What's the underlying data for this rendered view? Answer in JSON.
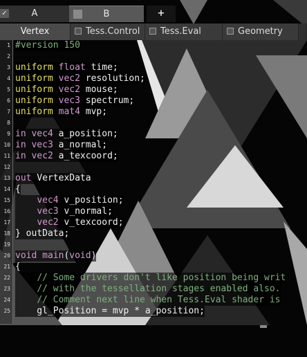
{
  "top_tabs": [
    {
      "label": "A",
      "checked": true
    },
    {
      "label": "B",
      "active": true
    },
    {
      "label": "+"
    }
  ],
  "shader_tabs": [
    {
      "label": "Vertex",
      "active": true
    },
    {
      "label": "Tess.Control"
    },
    {
      "label": "Tess.Eval"
    },
    {
      "label": "Geometry"
    }
  ],
  "editor": {
    "lines": [
      {
        "num": "1",
        "tokens": [
          {
            "t": "#version 150",
            "c": "dir"
          }
        ]
      },
      {
        "num": "2",
        "tokens": []
      },
      {
        "num": "3",
        "tokens": [
          {
            "t": "uniform",
            "c": "uni"
          },
          {
            "t": " "
          },
          {
            "t": "float",
            "c": "ty"
          },
          {
            "t": " time;"
          }
        ]
      },
      {
        "num": "4",
        "tokens": [
          {
            "t": "uniform",
            "c": "uni"
          },
          {
            "t": " "
          },
          {
            "t": "vec2",
            "c": "ty"
          },
          {
            "t": " resolution;"
          }
        ]
      },
      {
        "num": "5",
        "tokens": [
          {
            "t": "uniform",
            "c": "uni"
          },
          {
            "t": " "
          },
          {
            "t": "vec2",
            "c": "ty"
          },
          {
            "t": " mouse;"
          }
        ]
      },
      {
        "num": "6",
        "tokens": [
          {
            "t": "uniform",
            "c": "uni"
          },
          {
            "t": " "
          },
          {
            "t": "vec3",
            "c": "ty"
          },
          {
            "t": " spectrum;"
          }
        ]
      },
      {
        "num": "7",
        "tokens": [
          {
            "t": "uniform",
            "c": "uni"
          },
          {
            "t": " "
          },
          {
            "t": "mat4",
            "c": "ty"
          },
          {
            "t": " mvp;"
          }
        ]
      },
      {
        "num": "8",
        "tokens": []
      },
      {
        "num": "9",
        "tokens": [
          {
            "t": "in",
            "c": "kw"
          },
          {
            "t": " "
          },
          {
            "t": "vec4",
            "c": "ty"
          },
          {
            "t": " a_position;"
          }
        ]
      },
      {
        "num": "10",
        "tokens": [
          {
            "t": "in",
            "c": "kw"
          },
          {
            "t": " "
          },
          {
            "t": "vec3",
            "c": "ty"
          },
          {
            "t": " a_normal;"
          }
        ]
      },
      {
        "num": "11",
        "tokens": [
          {
            "t": "in",
            "c": "kw"
          },
          {
            "t": " "
          },
          {
            "t": "vec2",
            "c": "ty"
          },
          {
            "t": " a_texcoord;"
          }
        ]
      },
      {
        "num": "12",
        "tokens": []
      },
      {
        "num": "13",
        "tokens": [
          {
            "t": "out",
            "c": "kw"
          },
          {
            "t": " VertexData"
          }
        ]
      },
      {
        "num": "14",
        "tokens": [
          {
            "t": "{"
          }
        ]
      },
      {
        "num": "15",
        "tokens": [
          {
            "t": "    "
          },
          {
            "t": "vec4",
            "c": "ty"
          },
          {
            "t": " v_position;"
          }
        ]
      },
      {
        "num": "16",
        "tokens": [
          {
            "t": "    "
          },
          {
            "t": "vec3",
            "c": "ty"
          },
          {
            "t": " v_normal;"
          }
        ]
      },
      {
        "num": "17",
        "tokens": [
          {
            "t": "    "
          },
          {
            "t": "vec2",
            "c": "ty"
          },
          {
            "t": " v_texcoord;"
          }
        ]
      },
      {
        "num": "18",
        "tokens": [
          {
            "t": "} outData;"
          }
        ]
      },
      {
        "num": "19",
        "tokens": []
      },
      {
        "num": "20",
        "tokens": [
          {
            "t": "void",
            "c": "kw"
          },
          {
            "t": " "
          },
          {
            "t": "main",
            "c": "kw"
          },
          {
            "t": "("
          },
          {
            "t": "void",
            "c": "kw"
          },
          {
            "t": ")"
          }
        ]
      },
      {
        "num": "21",
        "tokens": [
          {
            "t": "{"
          }
        ]
      },
      {
        "num": "22",
        "tokens": [
          {
            "t": "    "
          },
          {
            "t": "// Some drivers don't like position being writ",
            "c": "com"
          }
        ]
      },
      {
        "num": "23",
        "tokens": [
          {
            "t": "    "
          },
          {
            "t": "// with the tessellation stages enabled also.",
            "c": "com"
          }
        ]
      },
      {
        "num": "24",
        "tokens": [
          {
            "t": "    "
          },
          {
            "t": "// Comment next line when Tess.Eval shader is",
            "c": "com"
          }
        ]
      },
      {
        "num": "25",
        "tokens": [
          {
            "t": "    gl_Position = mvp * a_position;"
          }
        ]
      }
    ]
  },
  "colors": {
    "keyword": "#d39ad0",
    "uniform": "#e5e06a",
    "comment": "#7fb07f",
    "text": "#f2f2f2",
    "tab_active": "#585858"
  }
}
